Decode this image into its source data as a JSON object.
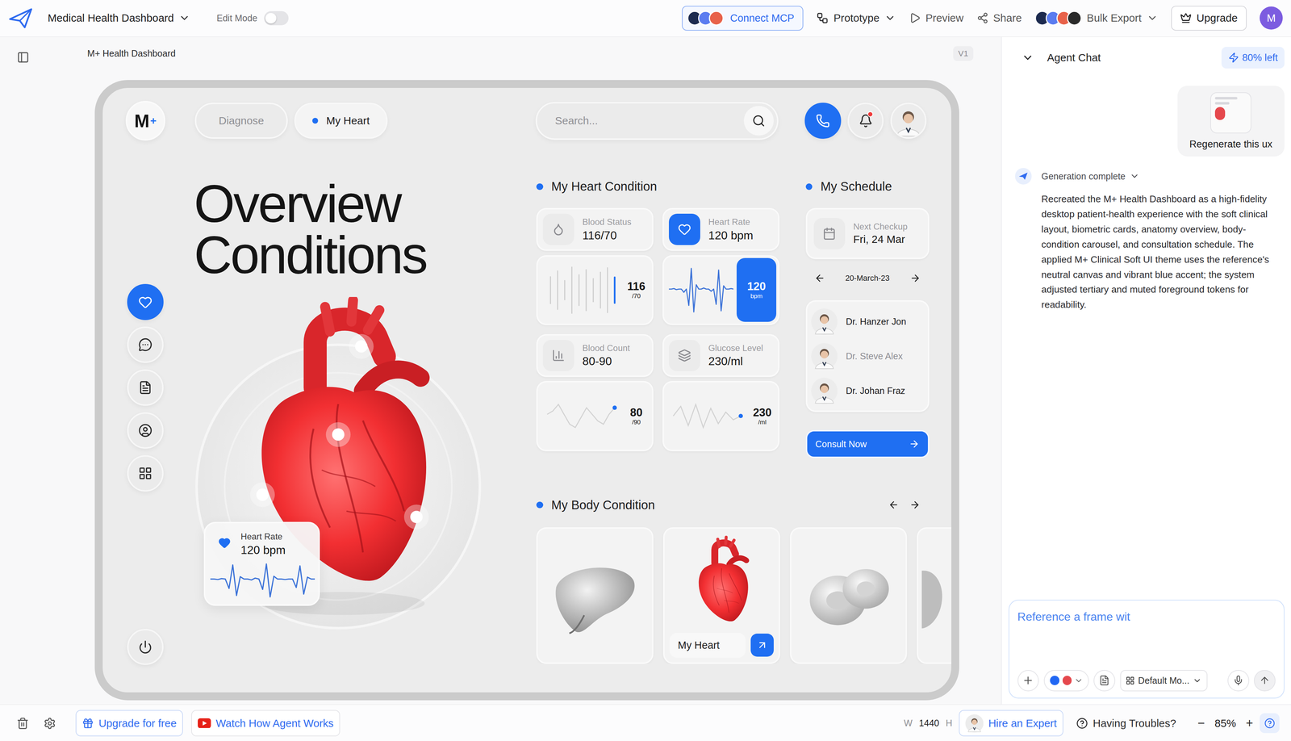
{
  "app": {
    "title": "Medical Health Dashboard",
    "edit_mode": {
      "label": "Edit Mode",
      "on": false
    }
  },
  "toolbar": {
    "connect": "Connect MCP",
    "prototype": "Prototype",
    "preview": "Preview",
    "share": "Share",
    "export": "Bulk Export",
    "upgrade": "Upgrade",
    "user_initial": "M"
  },
  "canvas": {
    "frame_label": "M+ Health Dashboard",
    "version": "V1"
  },
  "dashboard": {
    "logo": {
      "letter": "M",
      "mark": "+"
    },
    "tabs": [
      {
        "label": "Diagnose",
        "selected": false
      },
      {
        "label": "My Heart",
        "selected": true
      }
    ],
    "search": {
      "placeholder": "Search..."
    },
    "notifications": {
      "unread": true
    },
    "rail": [
      {
        "kind": "heart",
        "selected": true
      },
      {
        "kind": "chat",
        "selected": false
      },
      {
        "kind": "document",
        "selected": false
      },
      {
        "kind": "profile",
        "selected": false
      },
      {
        "kind": "apps",
        "selected": false
      }
    ],
    "heading": [
      "Overview",
      "Conditions"
    ],
    "heart_rate": {
      "label": "Heart Rate",
      "value": "120 bpm",
      "wave": [
        50,
        50,
        49,
        51,
        50,
        30,
        80,
        15,
        55,
        50,
        50,
        48,
        52,
        50,
        28,
        82,
        12,
        56,
        50,
        50,
        49,
        50,
        50,
        32,
        78,
        18,
        54,
        50,
        50
      ]
    },
    "heart_condition": {
      "title": "My Heart Condition",
      "cards": [
        {
          "kind": "blood-status",
          "label": "Blood Status",
          "value": "116/70",
          "selected": false,
          "chart": {
            "kind": "bars",
            "values": [
              42,
              60,
              30,
              72,
              48,
              64,
              36,
              56,
              70,
              40
            ],
            "highlight": 9
          },
          "reading": "116",
          "unit": "/70"
        },
        {
          "kind": "heart-rate",
          "label": "Heart Rate",
          "value": "120 bpm",
          "selected": true,
          "chart": {
            "kind": "wave",
            "values": [
              50,
              50,
              51,
              49,
              50,
              50,
              44,
              50,
              20,
              88,
              8,
              58,
              50,
              50,
              52,
              50,
              50,
              46,
              50,
              22,
              85,
              10,
              56,
              50,
              50,
              51,
              50
            ]
          },
          "reading": "120",
          "unit": "bpm"
        },
        {
          "kind": "blood-count",
          "label": "Blood Count",
          "value": "80-90",
          "selected": false,
          "chart": {
            "kind": "line",
            "values": [
              50,
              51,
              53,
              50,
              47,
              46,
              49,
              52,
              50,
              48,
              47,
              50,
              52
            ]
          },
          "reading": "80",
          "unit": "/90"
        },
        {
          "kind": "glucose",
          "label": "Glucose Level",
          "value": "230/ml",
          "selected": false,
          "chart": {
            "kind": "line",
            "values": [
              50,
              55,
              45,
              56,
              44,
              54,
              46,
              52,
              48,
              50
            ]
          },
          "reading": "230",
          "unit": "/ml"
        }
      ]
    },
    "schedule": {
      "title": "My Schedule",
      "next": {
        "label": "Next Checkup",
        "value": "Fri, 24 Mar"
      },
      "date": "20-March-23",
      "doctors": [
        {
          "name": "Dr. Hanzer Jon",
          "muted": false
        },
        {
          "name": "Dr. Steve Alex",
          "muted": true
        },
        {
          "name": "Dr. Johan Fraz",
          "muted": false
        }
      ],
      "cta": "Consult Now"
    },
    "body": {
      "title": "My Body Condition",
      "organs": [
        {
          "kind": "liver",
          "selected": false
        },
        {
          "kind": "heart",
          "label": "My Heart",
          "selected": true
        },
        {
          "kind": "cell",
          "selected": false
        },
        {
          "kind": "brain",
          "selected": false
        }
      ]
    }
  },
  "chat": {
    "title": "Agent Chat",
    "quota": "80% left",
    "request": "Regenerate this ux",
    "status": "Generation complete",
    "reply": "Recreated the M+ Health Dashboard as a high-fidelity desktop patient-health experience with the soft clinical layout, biometric cards, anatomy overview, body-condition carousel, and consultation schedule. The applied M+ Clinical Soft UI theme uses the reference's neutral canvas and vibrant blue accent; the system adjusted tertiary and muted foreground tokens for readability.",
    "composer": {
      "placeholder": "Reference a frame wit",
      "swatches": [
        {
          "color": "#2167f3"
        },
        {
          "color": "#e5484d"
        }
      ],
      "model": "Default Mo..."
    }
  },
  "status_bar": {
    "upgrade": "Upgrade for free",
    "tutorial": "Watch How Agent Works",
    "width_label": "W",
    "width": "1440",
    "height_label": "H",
    "expert": "Hire an Expert",
    "support": "Having Troubles?",
    "zoom_out": "−",
    "zoom": "85%",
    "zoom_in": "+"
  }
}
